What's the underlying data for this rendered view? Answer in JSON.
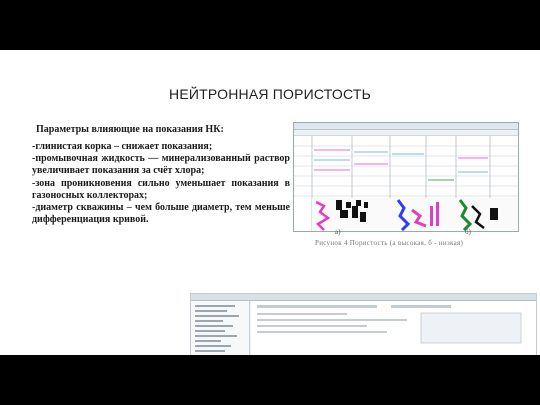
{
  "slide": {
    "title": "НЕЙТРОННАЯ ПОРИСТОСТЬ",
    "heading": "Параметры влияющие на показания НК:",
    "paragraphs": [
      "-глинистая корка – снижает показания;",
      "-промывочная жидкость — минерализованный раствор увеличивает показания за счёт хлора;",
      "-зона проникновения сильно уменьшает показания в газоносных коллекторах;",
      "-диаметр скважины – чем больше диаметр, тем меньше дифференциация кривой."
    ]
  },
  "figure": {
    "label_a": "а)",
    "label_b": "б)",
    "caption": "Рисунок 4     Пористость (а     высокая, б - низкая)"
  },
  "colors": {
    "track_magenta": "#e040c0",
    "track_blue": "#2c3cff",
    "track_green": "#1a8a2a",
    "track_black": "#111111"
  }
}
